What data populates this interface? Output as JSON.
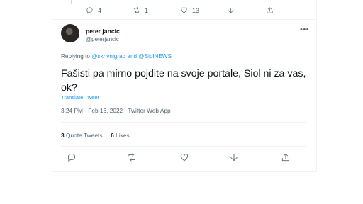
{
  "previous_tweet": {
    "reply_count": "4",
    "retweet_count": "1",
    "like_count": "13"
  },
  "tweet": {
    "author_name": "peter jancic",
    "author_handle": "@peterjancic",
    "more_label": "•••",
    "replying_to_prefix": "Replying to ",
    "replying_to_user1": "@skrivnigrad",
    "replying_to_and": " and ",
    "replying_to_user2": "@SiolNEWS",
    "text": "Fašisti pa mirno pojdite na svoje portale, Siol ni za vas, ok?",
    "translate_label": "Translate Tweet",
    "meta": "3:24 PM · Feb 16, 2022 · Twitter Web App",
    "quote_count": "3",
    "quote_label": "Quote Tweets",
    "like_count": "6",
    "like_label": "Likes"
  },
  "icons": {
    "reply": "reply-icon",
    "retweet": "retweet-icon",
    "like": "heart-icon",
    "share": "share-icon",
    "bookmark": "bookmark-icon"
  },
  "colors": {
    "link": "#1d9bf0",
    "secondary_text": "#536471",
    "primary_text": "#0f1419",
    "divider": "#eff3f4"
  }
}
